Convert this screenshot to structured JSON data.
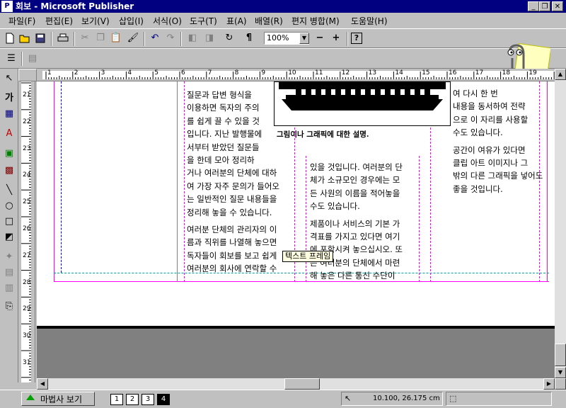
{
  "window": {
    "title": "회보 - Microsoft Publisher",
    "app_icon": "P"
  },
  "menu": [
    "파일(F)",
    "편집(E)",
    "보기(V)",
    "삽입(I)",
    "서식(O)",
    "도구(T)",
    "표(A)",
    "배열(R)",
    "편지 병합(M)",
    "도움말(H)"
  ],
  "toolbar": {
    "zoom_value": "100%",
    "zoom_out": "−",
    "zoom_in": "+"
  },
  "ruler": {
    "h_labels": [
      "1",
      "2",
      "3",
      "4",
      "5",
      "6",
      "7",
      "8",
      "9",
      "10",
      "11",
      "12",
      "13",
      "14",
      "15",
      "16",
      "17",
      "18",
      "19"
    ],
    "v_labels": [
      "21",
      "22",
      "23",
      "24",
      "25",
      "26",
      "27",
      "28",
      "29",
      "30",
      "31"
    ]
  },
  "document": {
    "col1": [
      "질문과 답변 형식을",
      "이용하면 독자의 주의",
      "를 쉽게 끌 수 있을 것",
      "입니다. 지난 발행물에",
      "서부터 받았던 질문들",
      "을 한데 모아 정리하",
      "거나 여러분의 단체에 대하",
      "여 가장 자주 문의가 들어오",
      "는 일반적인 질문 내용들을",
      "정리해 놓을 수 있습니다."
    ],
    "col1b": [
      "여러분 단체의 관리자의 이",
      "름과 직위를 나열해 놓으면",
      "독자들이 회보를 보고 쉽게",
      "여러분의 회사에 연락할 수"
    ],
    "caption": "그림이나 그래픽에 대한 설명.",
    "col2": [
      "있을 것입니다. 여러분의 단",
      "체가 소규모인 경우에는 모",
      "든 사원의 이름을 적어놓을",
      "수도 있습니다."
    ],
    "col2b": [
      "제품이나 서비스의 기본 가",
      "격표를 가지고 있다면 여기",
      "에 포함시켜 놓으십시오. 또",
      "는 여러분의 단체에서 마련",
      "해 놓은 다른 통신 수단이"
    ],
    "col3": [
      "여 다시 한 번",
      "내용을 동서하여 전략",
      "으로 이 자리를 사용할",
      "수도 있습니다."
    ],
    "col3b": [
      "공간이 여유가 있다면",
      "클립 아트 이미지나 그",
      "밖의 다른 그래픽을 넣어도",
      "좋을 것입니다."
    ],
    "tooltip": "텍스트 프레임"
  },
  "statusbar": {
    "wizard_label": "마법사 보기",
    "pages": [
      "1",
      "2",
      "3",
      "4"
    ],
    "active_page": "4",
    "coords": "10.100, 26.175 cm"
  }
}
